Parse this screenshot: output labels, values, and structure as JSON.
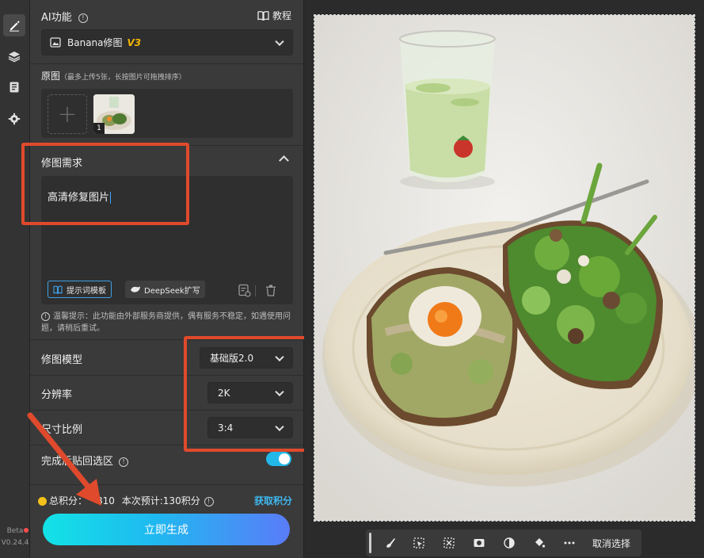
{
  "sidebar": {
    "version_line1": "Beta",
    "version_line2": "V0.24.4",
    "icons": [
      "pen-icon",
      "layers-icon",
      "save-icon",
      "gear-icon"
    ]
  },
  "ai_section": {
    "title": "AI功能",
    "tutorial": "教程",
    "model_select": "Banana修图",
    "model_version": "V3"
  },
  "original": {
    "title": "原图",
    "note": "（最多上传5张，长按图片可拖拽排序）",
    "thumb_index": "1"
  },
  "requirement": {
    "title": "修图需求",
    "text": "高清修复图片",
    "template_btn": "提示词模板",
    "deepseek_btn": "DeepSeek扩写",
    "tip": "温馨提示：此功能由外部服务商提供，偶有服务不稳定，如遇使用问题，请稍后重试。"
  },
  "settings": {
    "model_label": "修图模型",
    "model_value": "基础版2.0",
    "resolution_label": "分辨率",
    "resolution_value": "2K",
    "ratio_label": "尺寸比例",
    "ratio_value": "3:4",
    "paste_label": "完成后贴回选区",
    "paste_on": true
  },
  "footer": {
    "total_points_label": "总积分：",
    "total_points_value": "810",
    "estimate": "本次预计:130积分",
    "get_points": "获取积分",
    "generate": "立即生成"
  },
  "canvas_toolbar": {
    "deselect": "取消选择"
  },
  "colors": {
    "accent": "#22b8e8",
    "link": "#3fb8f0",
    "annotation": "#e04a2c",
    "model_version": "#f4b400"
  }
}
